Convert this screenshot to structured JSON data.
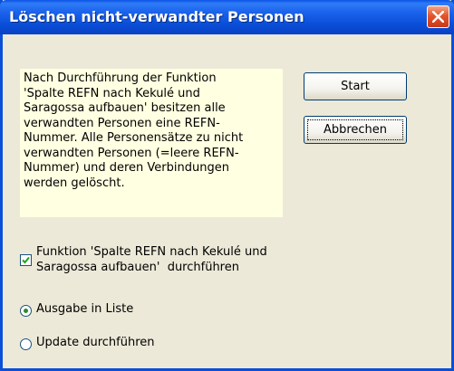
{
  "window": {
    "title": "Löschen nicht-verwandter Personen"
  },
  "info": {
    "text_lines": [
      "Nach Durchführung der Funktion",
      "'Spalte REFN nach Kekulé und",
      "Saragossa aufbauen' besitzen alle",
      "verwandten Personen eine REFN-",
      "Nummer. Alle Personensätze zu nicht",
      "verwandten Personen (=leere REFN-",
      "Nummer) und deren Verbindungen",
      "werden gelöscht."
    ]
  },
  "buttons": {
    "start_label": "Start",
    "cancel_label": "Abbrechen"
  },
  "option_run": {
    "label_lines": [
      "Funktion 'Spalte REFN nach Kekulé und",
      "Saragossa aufbauen'  durchführen"
    ],
    "checked": true
  },
  "output_mode": {
    "options": [
      {
        "label": "Ausgabe in Liste",
        "selected": true
      },
      {
        "label": "Update durchführen",
        "selected": false
      }
    ]
  },
  "colors": {
    "title_bar": "#0a4fd8",
    "dialog_bg": "#ece9d8",
    "info_bg": "#ffffe1",
    "close_button": "#e2552d"
  }
}
